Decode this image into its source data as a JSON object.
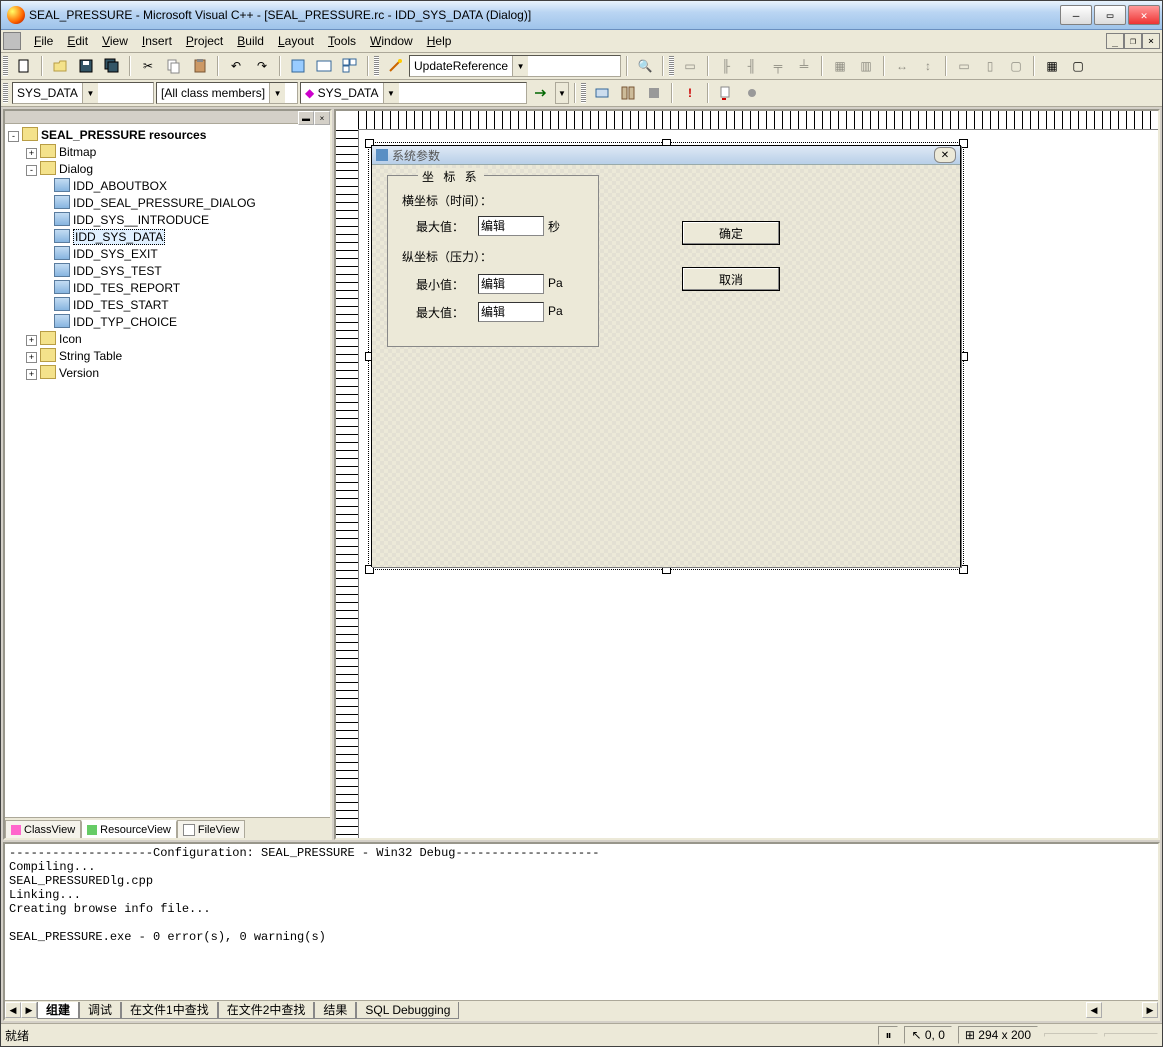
{
  "title": "SEAL_PRESSURE - Microsoft Visual C++ - [SEAL_PRESSURE.rc - IDD_SYS_DATA (Dialog)]",
  "menu": {
    "file": "File",
    "edit": "Edit",
    "view": "View",
    "insert": "Insert",
    "project": "Project",
    "build": "Build",
    "layout": "Layout",
    "tools": "Tools",
    "window": "Window",
    "help": "Help"
  },
  "toolbar": {
    "wizard_combo": "UpdateReference"
  },
  "combo": {
    "class": "SYS_DATA",
    "filter": "[All class members]",
    "member_prefix": "◆",
    "member": "SYS_DATA"
  },
  "tree": {
    "root": "SEAL_PRESSURE resources",
    "bitmap": "Bitmap",
    "dialog": "Dialog",
    "dialogs": [
      "IDD_ABOUTBOX",
      "IDD_SEAL_PRESSURE_DIALOG",
      "IDD_SYS__INTRODUCE",
      "IDD_SYS_DATA",
      "IDD_SYS_EXIT",
      "IDD_SYS_TEST",
      "IDD_TES_REPORT",
      "IDD_TES_START",
      "IDD_TYP_CHOICE"
    ],
    "icon": "Icon",
    "stringtable": "String Table",
    "version": "Version"
  },
  "ws_tabs": {
    "class": "ClassView",
    "resource": "ResourceView",
    "file": "FileView"
  },
  "dialog": {
    "title": "系统参数",
    "group": "坐 标 系",
    "x_label": "横坐标（时间）：",
    "x_max": "最大值：",
    "x_unit": "秒",
    "y_label": "纵坐标（压力）：",
    "y_min": "最小值：",
    "y_max": "最大值：",
    "y_unit": "Pa",
    "edit": "编辑",
    "ok": "确定",
    "cancel": "取消"
  },
  "output": {
    "text": "--------------------Configuration: SEAL_PRESSURE - Win32 Debug--------------------\nCompiling...\nSEAL_PRESSUREDlg.cpp\nLinking...\nCreating browse info file...\n\nSEAL_PRESSURE.exe - 0 error(s), 0 warning(s)",
    "tabs": {
      "build": "组建",
      "debug": "调试",
      "find1": "在文件1中查找",
      "find2": "在文件2中查找",
      "result": "结果",
      "sql": "SQL Debugging"
    }
  },
  "status": {
    "ready": "就绪",
    "pos": "0, 0",
    "size": "294 x 200"
  }
}
